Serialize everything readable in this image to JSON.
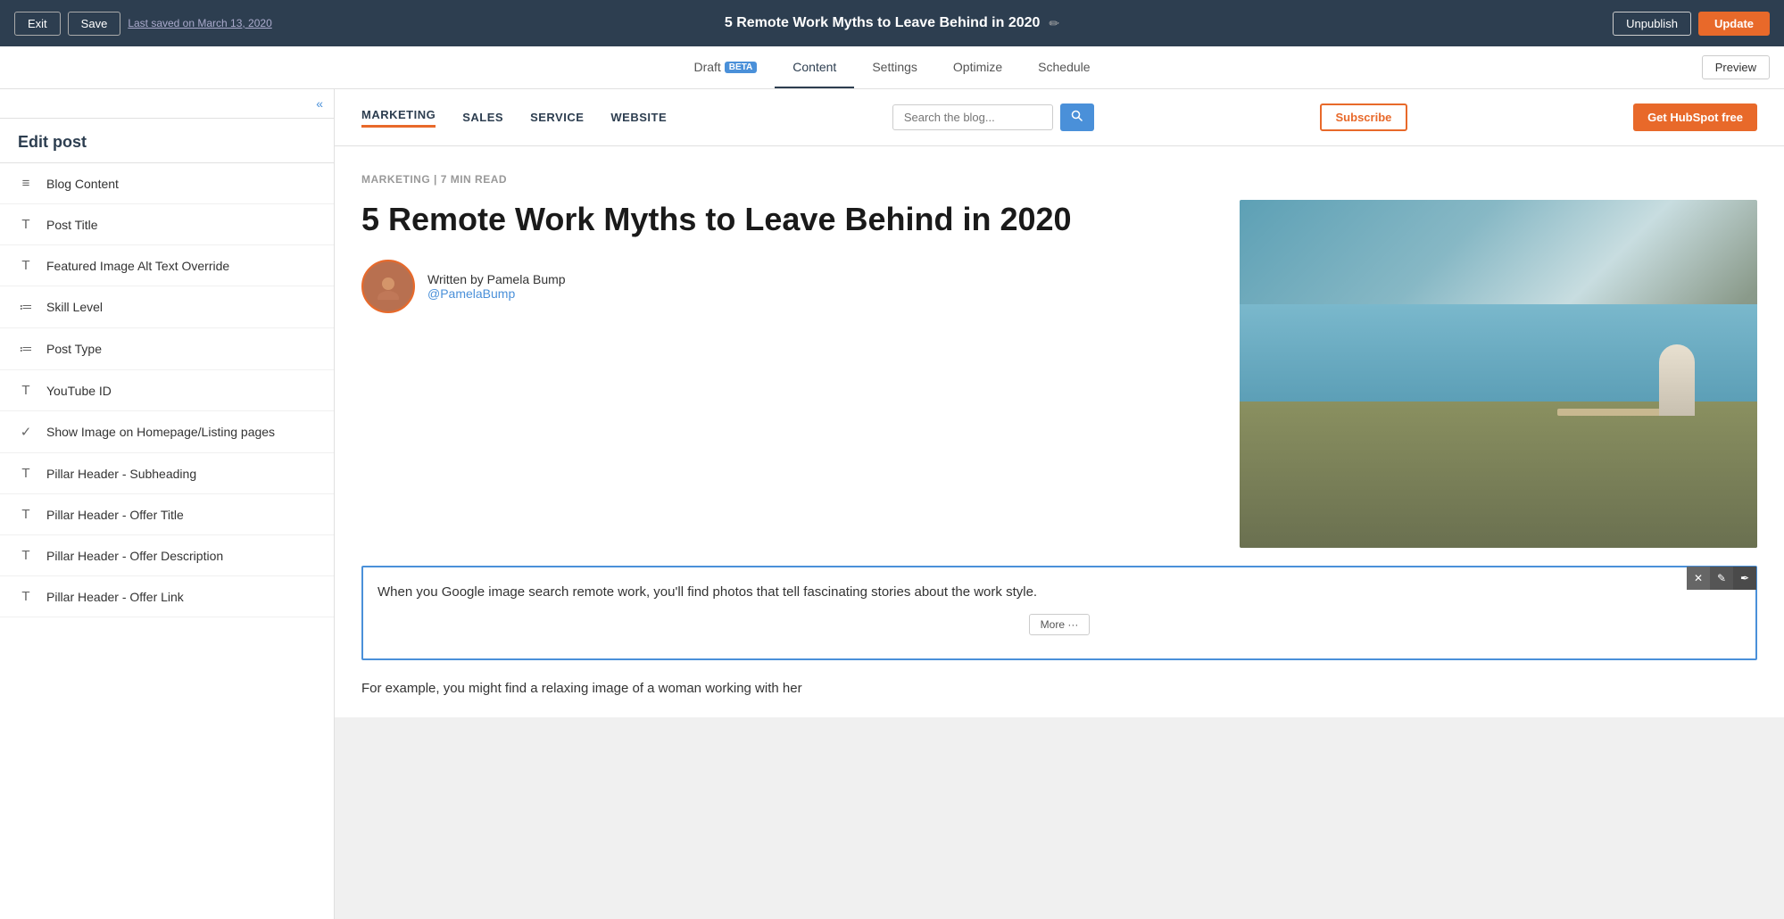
{
  "topbar": {
    "exit_label": "Exit",
    "save_label": "Save",
    "last_saved": "Last saved on March 13, 2020",
    "page_title": "5 Remote Work Myths to Leave Behind in 2020",
    "unpublish_label": "Unpublish",
    "update_label": "Update"
  },
  "nav_tabs": {
    "tabs": [
      {
        "label": "Draft",
        "badge": "BETA",
        "active": false
      },
      {
        "label": "Content",
        "active": true
      },
      {
        "label": "Settings",
        "active": false
      },
      {
        "label": "Optimize",
        "active": false
      },
      {
        "label": "Schedule",
        "active": false
      }
    ],
    "preview_label": "Preview"
  },
  "sidebar": {
    "title": "Edit post",
    "items": [
      {
        "icon": "≡≡",
        "label": "Blog Content",
        "type": "content"
      },
      {
        "icon": "T",
        "label": "Post Title",
        "type": "text"
      },
      {
        "icon": "T",
        "label": "Featured Image Alt Text Override",
        "type": "text"
      },
      {
        "icon": "≔",
        "label": "Skill Level",
        "type": "list"
      },
      {
        "icon": "≔",
        "label": "Post Type",
        "type": "list"
      },
      {
        "icon": "T",
        "label": "YouTube ID",
        "type": "text"
      },
      {
        "icon": "✓",
        "label": "Show Image on Homepage/Listing pages",
        "type": "check"
      },
      {
        "icon": "T",
        "label": "Pillar Header - Subheading",
        "type": "text"
      },
      {
        "icon": "T",
        "label": "Pillar Header - Offer Title",
        "type": "text"
      },
      {
        "icon": "T",
        "label": "Pillar Header - Offer Description",
        "type": "text"
      },
      {
        "icon": "T",
        "label": "Pillar Header - Offer Link",
        "type": "text"
      }
    ]
  },
  "blog_header": {
    "nav_items": [
      "MARKETING",
      "SALES",
      "SERVICE",
      "WEBSITE"
    ],
    "search_placeholder": "Search the blog...",
    "subscribe_label": "Subscribe",
    "hubspot_label": "Get HubSpot free"
  },
  "post": {
    "category": "MARKETING",
    "read_time": "7 MIN READ",
    "title": "5 Remote Work Myths to Leave Behind in 2020",
    "author_name": "Written by Pamela Bump",
    "author_handle": "@PamelaBump",
    "text_box_content": "When you Google image search remote work, you'll find photos that tell fascinating stories about the work style.",
    "text_box_content2": "For example, you might find a relaxing image of a woman working with her",
    "more_label": "More ···"
  }
}
